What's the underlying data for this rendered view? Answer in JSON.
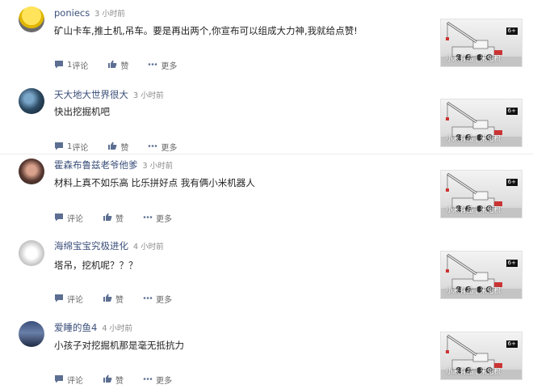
{
  "actions": {
    "reply_label": "评论",
    "like_label": "赞",
    "more_label": "更多"
  },
  "thumbnail": {
    "badge": "6+",
    "watermark": "小米有品 | 米兔积"
  },
  "comments": [
    {
      "user": "poniecs",
      "time": "3 小时前",
      "text": "矿山卡车,推土机,吊车。要是再出两个,你宣布可以组成大力神,我就给点赞!",
      "reply_count": "1"
    },
    {
      "user": "天大地大世界很大",
      "time": "3 小时前",
      "text": "快出挖掘机吧",
      "reply_count": "1"
    },
    {
      "user": "霍森布鲁兹老爷他爹",
      "time": "3 小时前",
      "text": "材料上真不如乐高 比乐拼好点 我有俩小米机器人",
      "reply_count": ""
    },
    {
      "user": "海绵宝宝究极进化",
      "time": "4 小时前",
      "text": "塔吊，挖机呢？？？",
      "reply_count": ""
    },
    {
      "user": "爱睡的鱼4",
      "time": "4 小时前",
      "text": "小孩子对挖掘机那是毫无抵抗力",
      "reply_count": ""
    }
  ]
}
